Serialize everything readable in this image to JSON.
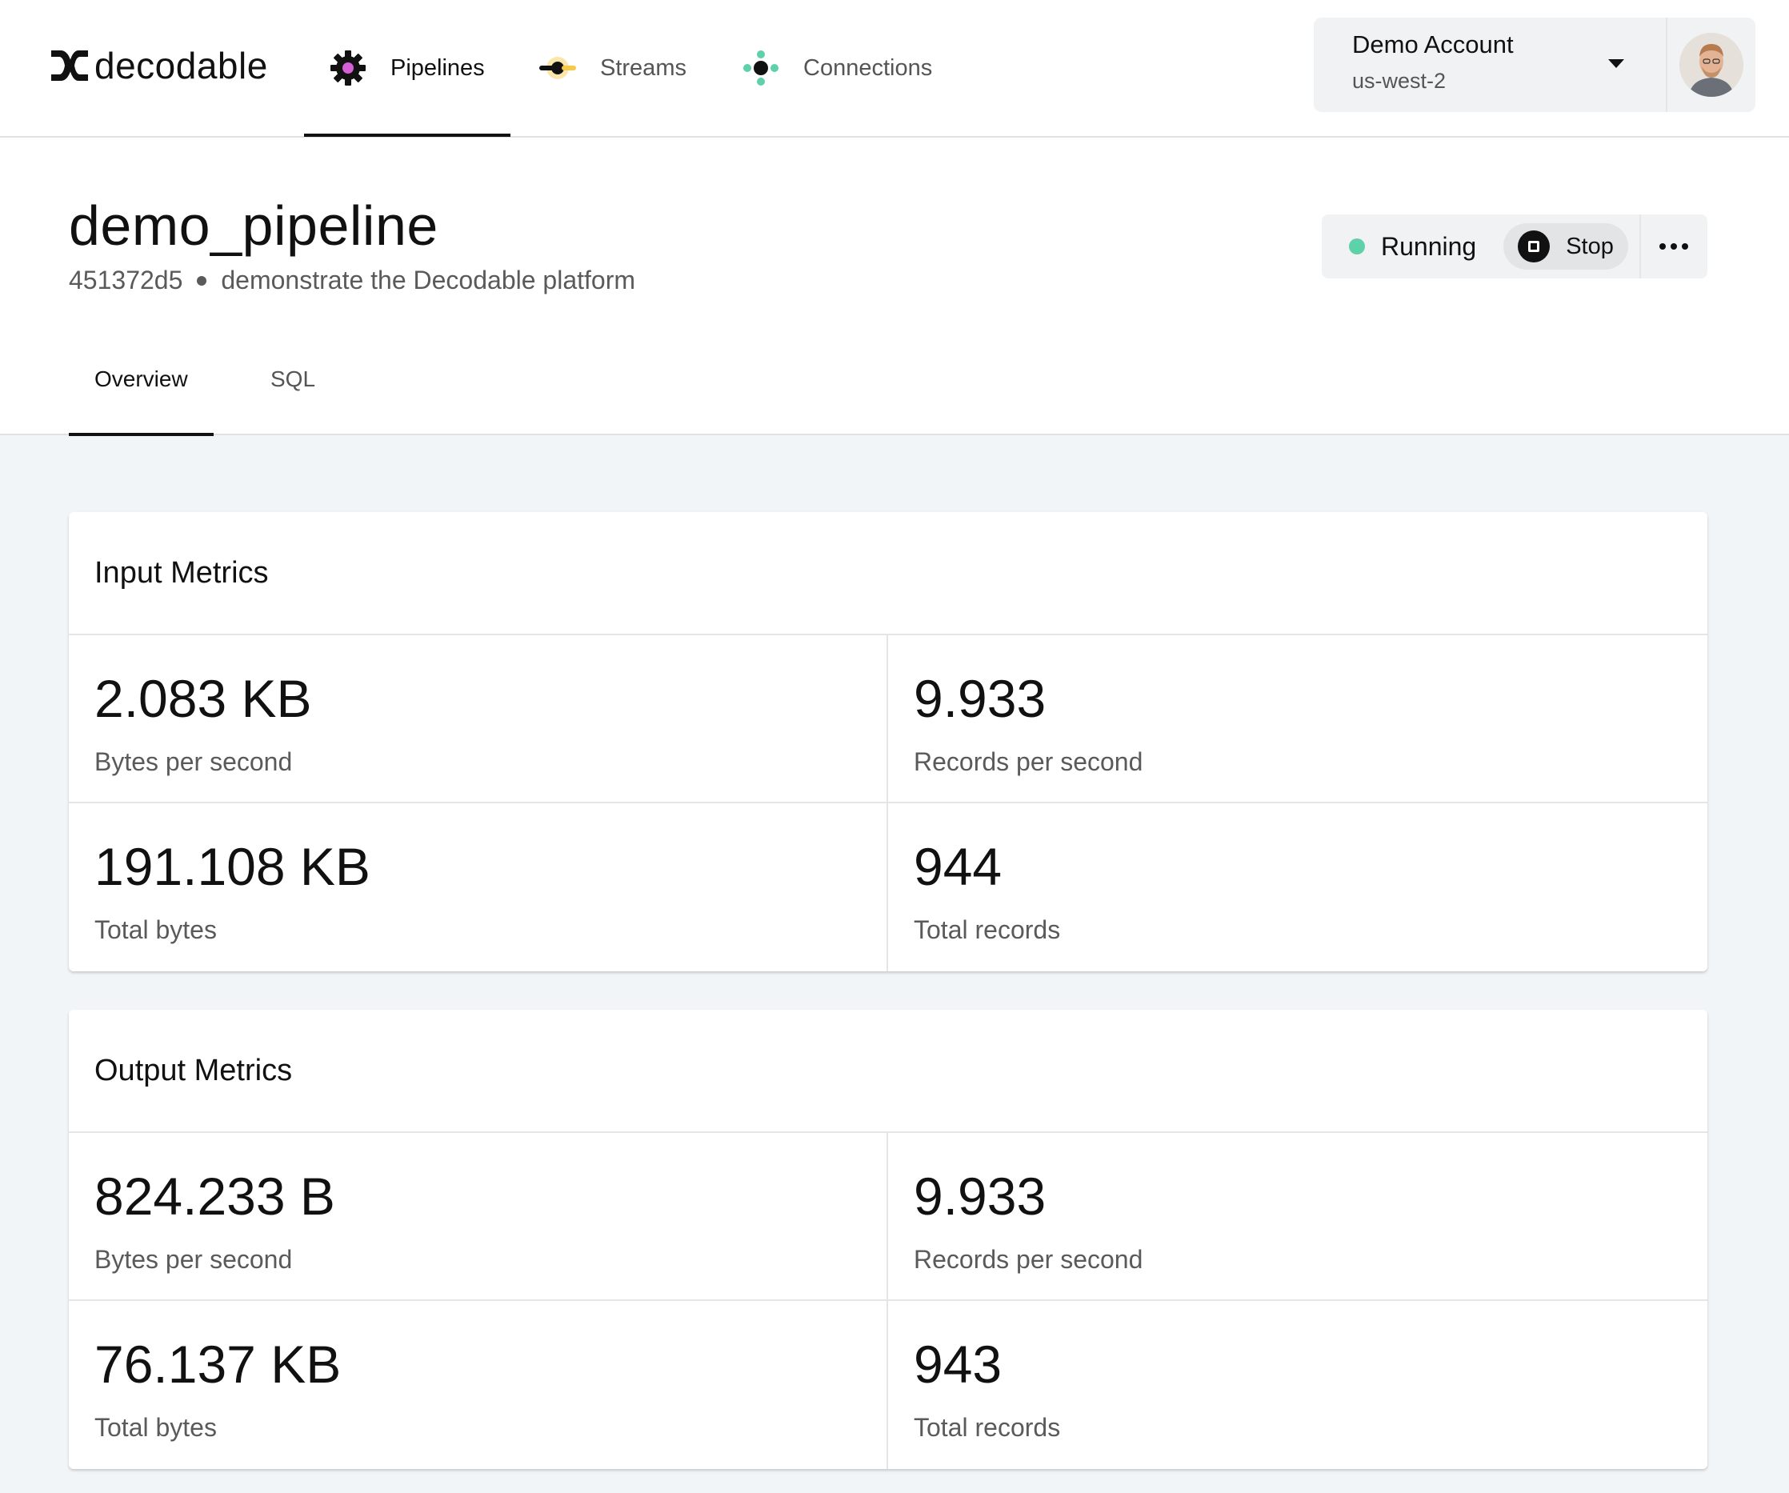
{
  "brand": {
    "name": "decodable"
  },
  "nav": {
    "items": [
      {
        "label": "Pipelines",
        "icon": "gear-icon",
        "active": true
      },
      {
        "label": "Streams",
        "icon": "stream-icon",
        "active": false
      },
      {
        "label": "Connections",
        "icon": "connections-icon",
        "active": false
      }
    ]
  },
  "account": {
    "name": "Demo Account",
    "region": "us-west-2"
  },
  "pipeline": {
    "name": "demo_pipeline",
    "id": "451372d5",
    "description": "demonstrate the Decodable platform",
    "status": "Running",
    "stop_label": "Stop"
  },
  "tabs": [
    {
      "label": "Overview",
      "active": true
    },
    {
      "label": "SQL",
      "active": false
    }
  ],
  "input_metrics": {
    "title": "Input Metrics",
    "bytes_per_second": {
      "value": "2.083 KB",
      "label": "Bytes per second"
    },
    "records_per_second": {
      "value": "9.933",
      "label": "Records per second"
    },
    "total_bytes": {
      "value": "191.108 KB",
      "label": "Total bytes"
    },
    "total_records": {
      "value": "944",
      "label": "Total records"
    }
  },
  "output_metrics": {
    "title": "Output Metrics",
    "bytes_per_second": {
      "value": "824.233 B",
      "label": "Bytes per second"
    },
    "records_per_second": {
      "value": "9.933",
      "label": "Records per second"
    },
    "total_bytes": {
      "value": "76.137 KB",
      "label": "Total bytes"
    },
    "total_records": {
      "value": "943",
      "label": "Total records"
    }
  },
  "colors": {
    "running": "#5dd1a8",
    "pipelines_accent": "#d45fd6",
    "streams_accent": "#f7c948",
    "connections_accent": "#5dd1a8"
  }
}
